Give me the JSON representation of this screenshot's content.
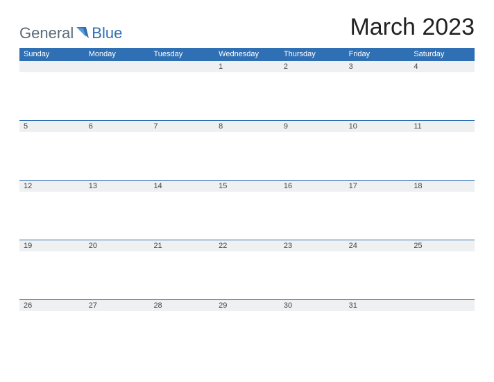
{
  "logo": {
    "part1": "General",
    "part2": "Blue"
  },
  "title": "March 2023",
  "days": [
    "Sunday",
    "Monday",
    "Tuesday",
    "Wednesday",
    "Thursday",
    "Friday",
    "Saturday"
  ],
  "weeks": [
    [
      "",
      "",
      "",
      "1",
      "2",
      "3",
      "4"
    ],
    [
      "5",
      "6",
      "7",
      "8",
      "9",
      "10",
      "11"
    ],
    [
      "12",
      "13",
      "14",
      "15",
      "16",
      "17",
      "18"
    ],
    [
      "19",
      "20",
      "21",
      "22",
      "23",
      "24",
      "25"
    ],
    [
      "26",
      "27",
      "28",
      "29",
      "30",
      "31",
      ""
    ]
  ]
}
